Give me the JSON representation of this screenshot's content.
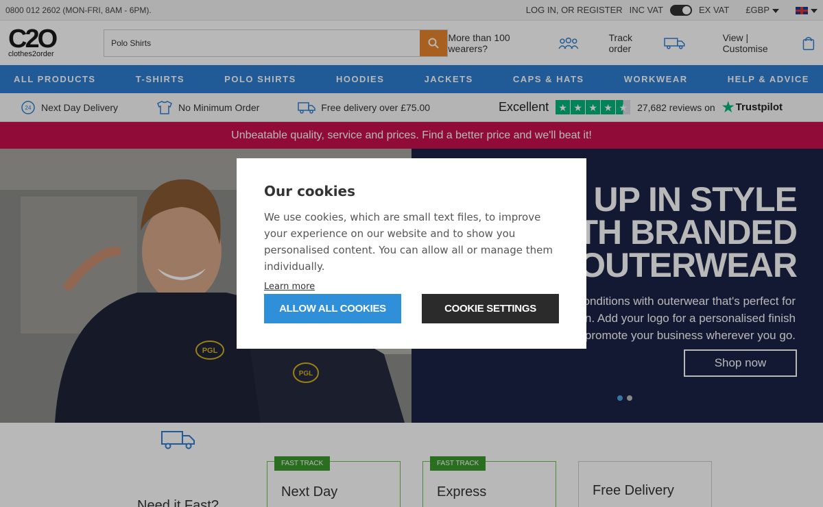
{
  "topbar": {
    "phone": "0800 012 2602 (MON-FRI, 8AM - 6PM).",
    "login": "LOG IN, OR REGISTER",
    "inc_vat": "INC VAT",
    "ex_vat": "EX VAT",
    "currency": "£GBP"
  },
  "header": {
    "logo_mark": "C2O",
    "logo_sub": "clothes2order",
    "search_value": "Polo Shirts",
    "wearers": "More than 100 wearers?",
    "track": "Track order",
    "view_customise": "View | Customise"
  },
  "nav": [
    "ALL PRODUCTS",
    "T-SHIRTS",
    "POLO SHIRTS",
    "HOODIES",
    "JACKETS",
    "CAPS & HATS",
    "WORKWEAR",
    "HELP & ADVICE"
  ],
  "usp": {
    "next_day": "Next Day Delivery",
    "no_min": "No Minimum Order",
    "free_delivery": "Free delivery over £75.00",
    "rating_word": "Excellent",
    "reviews": "27,682 reviews on",
    "trustpilot": "Trustpilot",
    "stars": 4.5
  },
  "promo": "Unbeatable quality, service and prices. Find a better price and we'll beat it!",
  "hero": {
    "heading_lines": [
      "R UP IN STYLE",
      "TH BRANDED",
      "OUTERWEAR"
    ],
    "body_lines": [
      "onditions with outerwear that's perfect for",
      "n. Add your logo for a personalised finish",
      "promote your business wherever you go."
    ],
    "cta": "Shop now",
    "slide_count": 2,
    "active_slide": 1,
    "badge_text": "PGL"
  },
  "services": {
    "question": "Need it Fast?",
    "cards": [
      {
        "badge": "FAST TRACK",
        "title": "Next Day"
      },
      {
        "badge": "FAST TRACK",
        "title": "Express"
      },
      {
        "badge": "",
        "title": "Free Delivery"
      }
    ]
  },
  "cookie": {
    "title": "Our cookies",
    "body": "We use cookies, which are small text files, to improve your experience on our website and to show you personalised content. You can allow all or manage them individually.",
    "learn_more": "Learn more",
    "allow_all": "ALLOW ALL COOKIES",
    "settings": "COOKIE SETTINGS"
  },
  "colors": {
    "nav_blue": "#2f7fd1",
    "promo_pink": "#c8104e",
    "search_orange": "#e8862b",
    "trustpilot_green": "#00b67a",
    "hero_navy": "#1b2247"
  }
}
